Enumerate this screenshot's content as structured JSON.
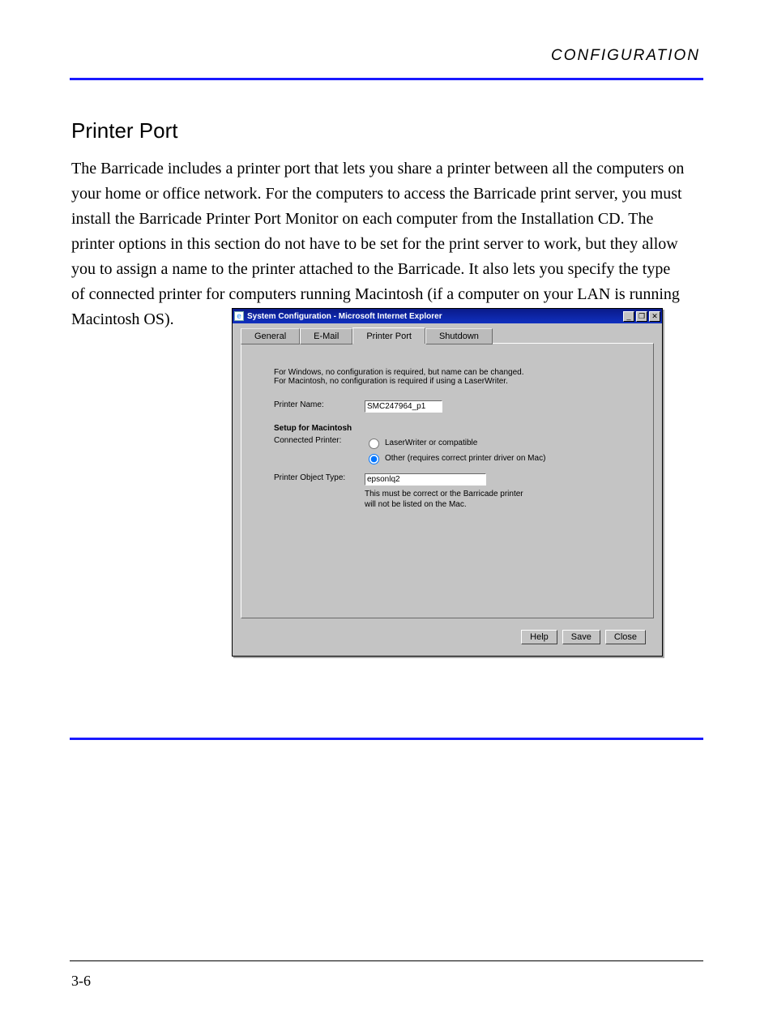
{
  "header": {
    "right": "CONFIGURATION"
  },
  "section_title": "Printer Port",
  "body_text": "The Barricade includes a printer port that lets you share a printer between all the computers on your home or office network. For the computers to access the Barricade print server, you must install the Barricade Printer Port Monitor on each computer from the Installation CD. The printer options in this section do not have to be set for the print server to work, but they allow you to assign a name to the printer attached to the Barricade. It also lets you specify the type of connected printer for computers running Macintosh (if a computer on your LAN is running Macintosh OS).",
  "window": {
    "title": "System Configuration - Microsoft Internet Explorer",
    "ie_icon": "e",
    "btn_min": "_",
    "btn_max": "❐",
    "btn_close": "✕",
    "tabs": [
      "General",
      "E-Mail",
      "Printer Port",
      "Shutdown"
    ],
    "active_tab_index": 2,
    "info_line1": "For Windows, no configuration is required, but name can be changed.",
    "info_line2": "For Macintosh, no configuration is required if using a LaserWriter.",
    "printer_name_label": "Printer Name:",
    "printer_name_value": "SMC247964_p1",
    "mac_heading": "Setup for Macintosh",
    "connected_printer_label": "Connected Printer:",
    "radio_laserwriter": "LaserWriter or compatible",
    "radio_other": "Other (requires correct printer driver on Mac)",
    "printer_object_type_label": "Printer Object Type:",
    "printer_object_type_value": "epsonlq2",
    "object_hint": "This must be correct or the Barricade printer will not be listed on the Mac.",
    "buttons": {
      "help": "Help",
      "save": "Save",
      "close": "Close"
    }
  },
  "footer": {
    "page": "3-6"
  }
}
